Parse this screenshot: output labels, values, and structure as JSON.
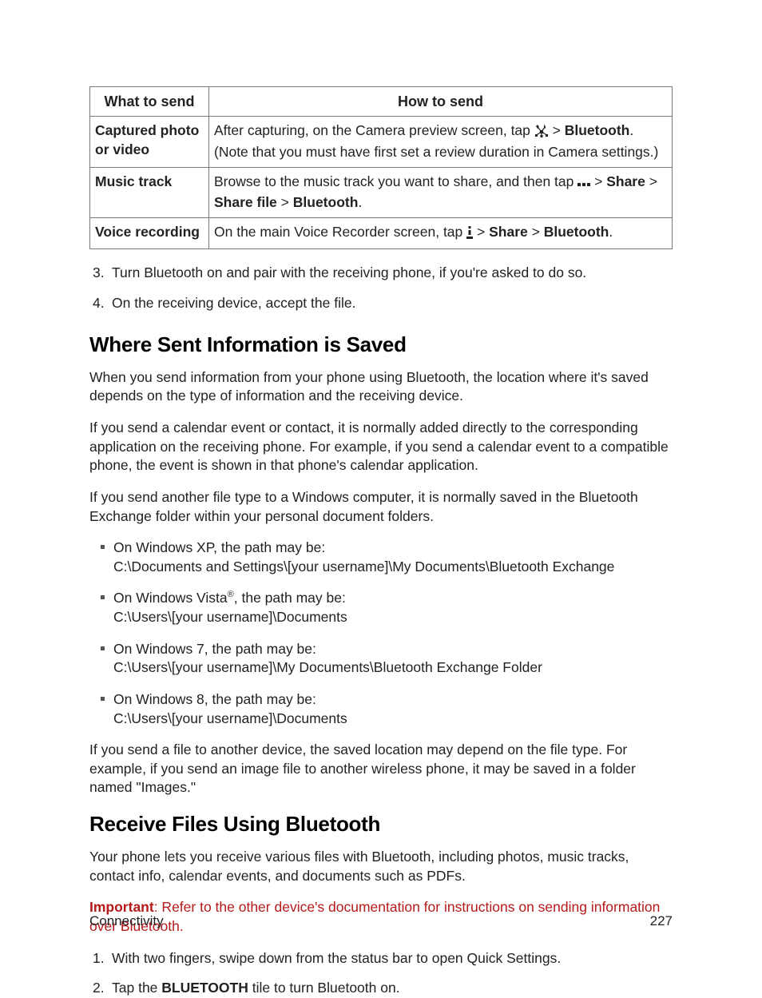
{
  "table": {
    "headers": [
      "What to send",
      "How to send"
    ],
    "rows": [
      {
        "label": "Captured photo or video",
        "prefix": "After capturing, on the Camera preview screen, tap ",
        "icon": "share-cross-icon",
        "mid1": " > ",
        "s1": "Bluetooth",
        "note": ". (Note that you must have first set a review duration in Camera settings.)"
      },
      {
        "label": "Music track",
        "prefix": "Browse to the music track you want to share, and then tap ",
        "icon": "more-dots-icon",
        "mid1": " > ",
        "s1": "Share",
        "mid2": " > ",
        "s2": "Share file",
        "mid3": " > ",
        "s3": "Bluetooth",
        "suffix": "."
      },
      {
        "label": "Voice recording",
        "prefix": "On the main Voice Recorder screen, tap ",
        "icon": "menu-dots-icon",
        "mid1": " > ",
        "s1": "Share",
        "mid2": " > ",
        "s2": "Bluetooth",
        "suffix": "."
      }
    ]
  },
  "steps_a": {
    "3": "Turn Bluetooth on and pair with the receiving phone, if you're asked to do so.",
    "4": "On the receiving device, accept the file."
  },
  "h2a": "Where Sent Information is Saved",
  "p1": "When you send information from your phone using Bluetooth, the location where it's saved depends on the type of information and the receiving device.",
  "p2": "If you send a calendar event or contact, it is normally added directly to the corresponding application on the receiving phone. For example, if you send a calendar event to a compatible phone, the event is shown in that phone's calendar application.",
  "p3": "If you send another file type to a Windows computer, it is normally saved in the Bluetooth Exchange folder within your personal document folders.",
  "paths": [
    {
      "a": "On Windows XP, the path may be:",
      "b": "C:\\Documents and Settings\\[your username]\\My Documents\\Bluetooth Exchange"
    },
    {
      "a_pre": "On Windows Vista",
      "a_sup": "®",
      "a_post": ", the path may be:",
      "b": "C:\\Users\\[your username]\\Documents"
    },
    {
      "a": "On Windows 7, the path may be:",
      "b": "C:\\Users\\[your username]\\My Documents\\Bluetooth Exchange Folder"
    },
    {
      "a": "On Windows 8, the path may be:",
      "b": "C:\\Users\\[your username]\\Documents"
    }
  ],
  "p4": "If you send a file to another device, the saved location may depend on the file type. For example, if you send an image file to another wireless phone, it may be saved in a folder named \"Images.\"",
  "h2b": "Receive Files Using Bluetooth",
  "p5": "Your phone lets you receive various files with Bluetooth, including photos, music tracks, contact info, calendar events, and documents such as PDFs.",
  "important_label": "Important",
  "important_text": ": Refer to the other device's documentation for instructions on sending information over Bluetooth.",
  "steps_b": {
    "1": "With two fingers, swipe down from the status bar to open Quick Settings.",
    "2_pre": "Tap the ",
    "2_bold": "BLUETOOTH",
    "2_post": " tile to turn Bluetooth on."
  },
  "footer": {
    "section": "Connectivity",
    "page": "227"
  }
}
